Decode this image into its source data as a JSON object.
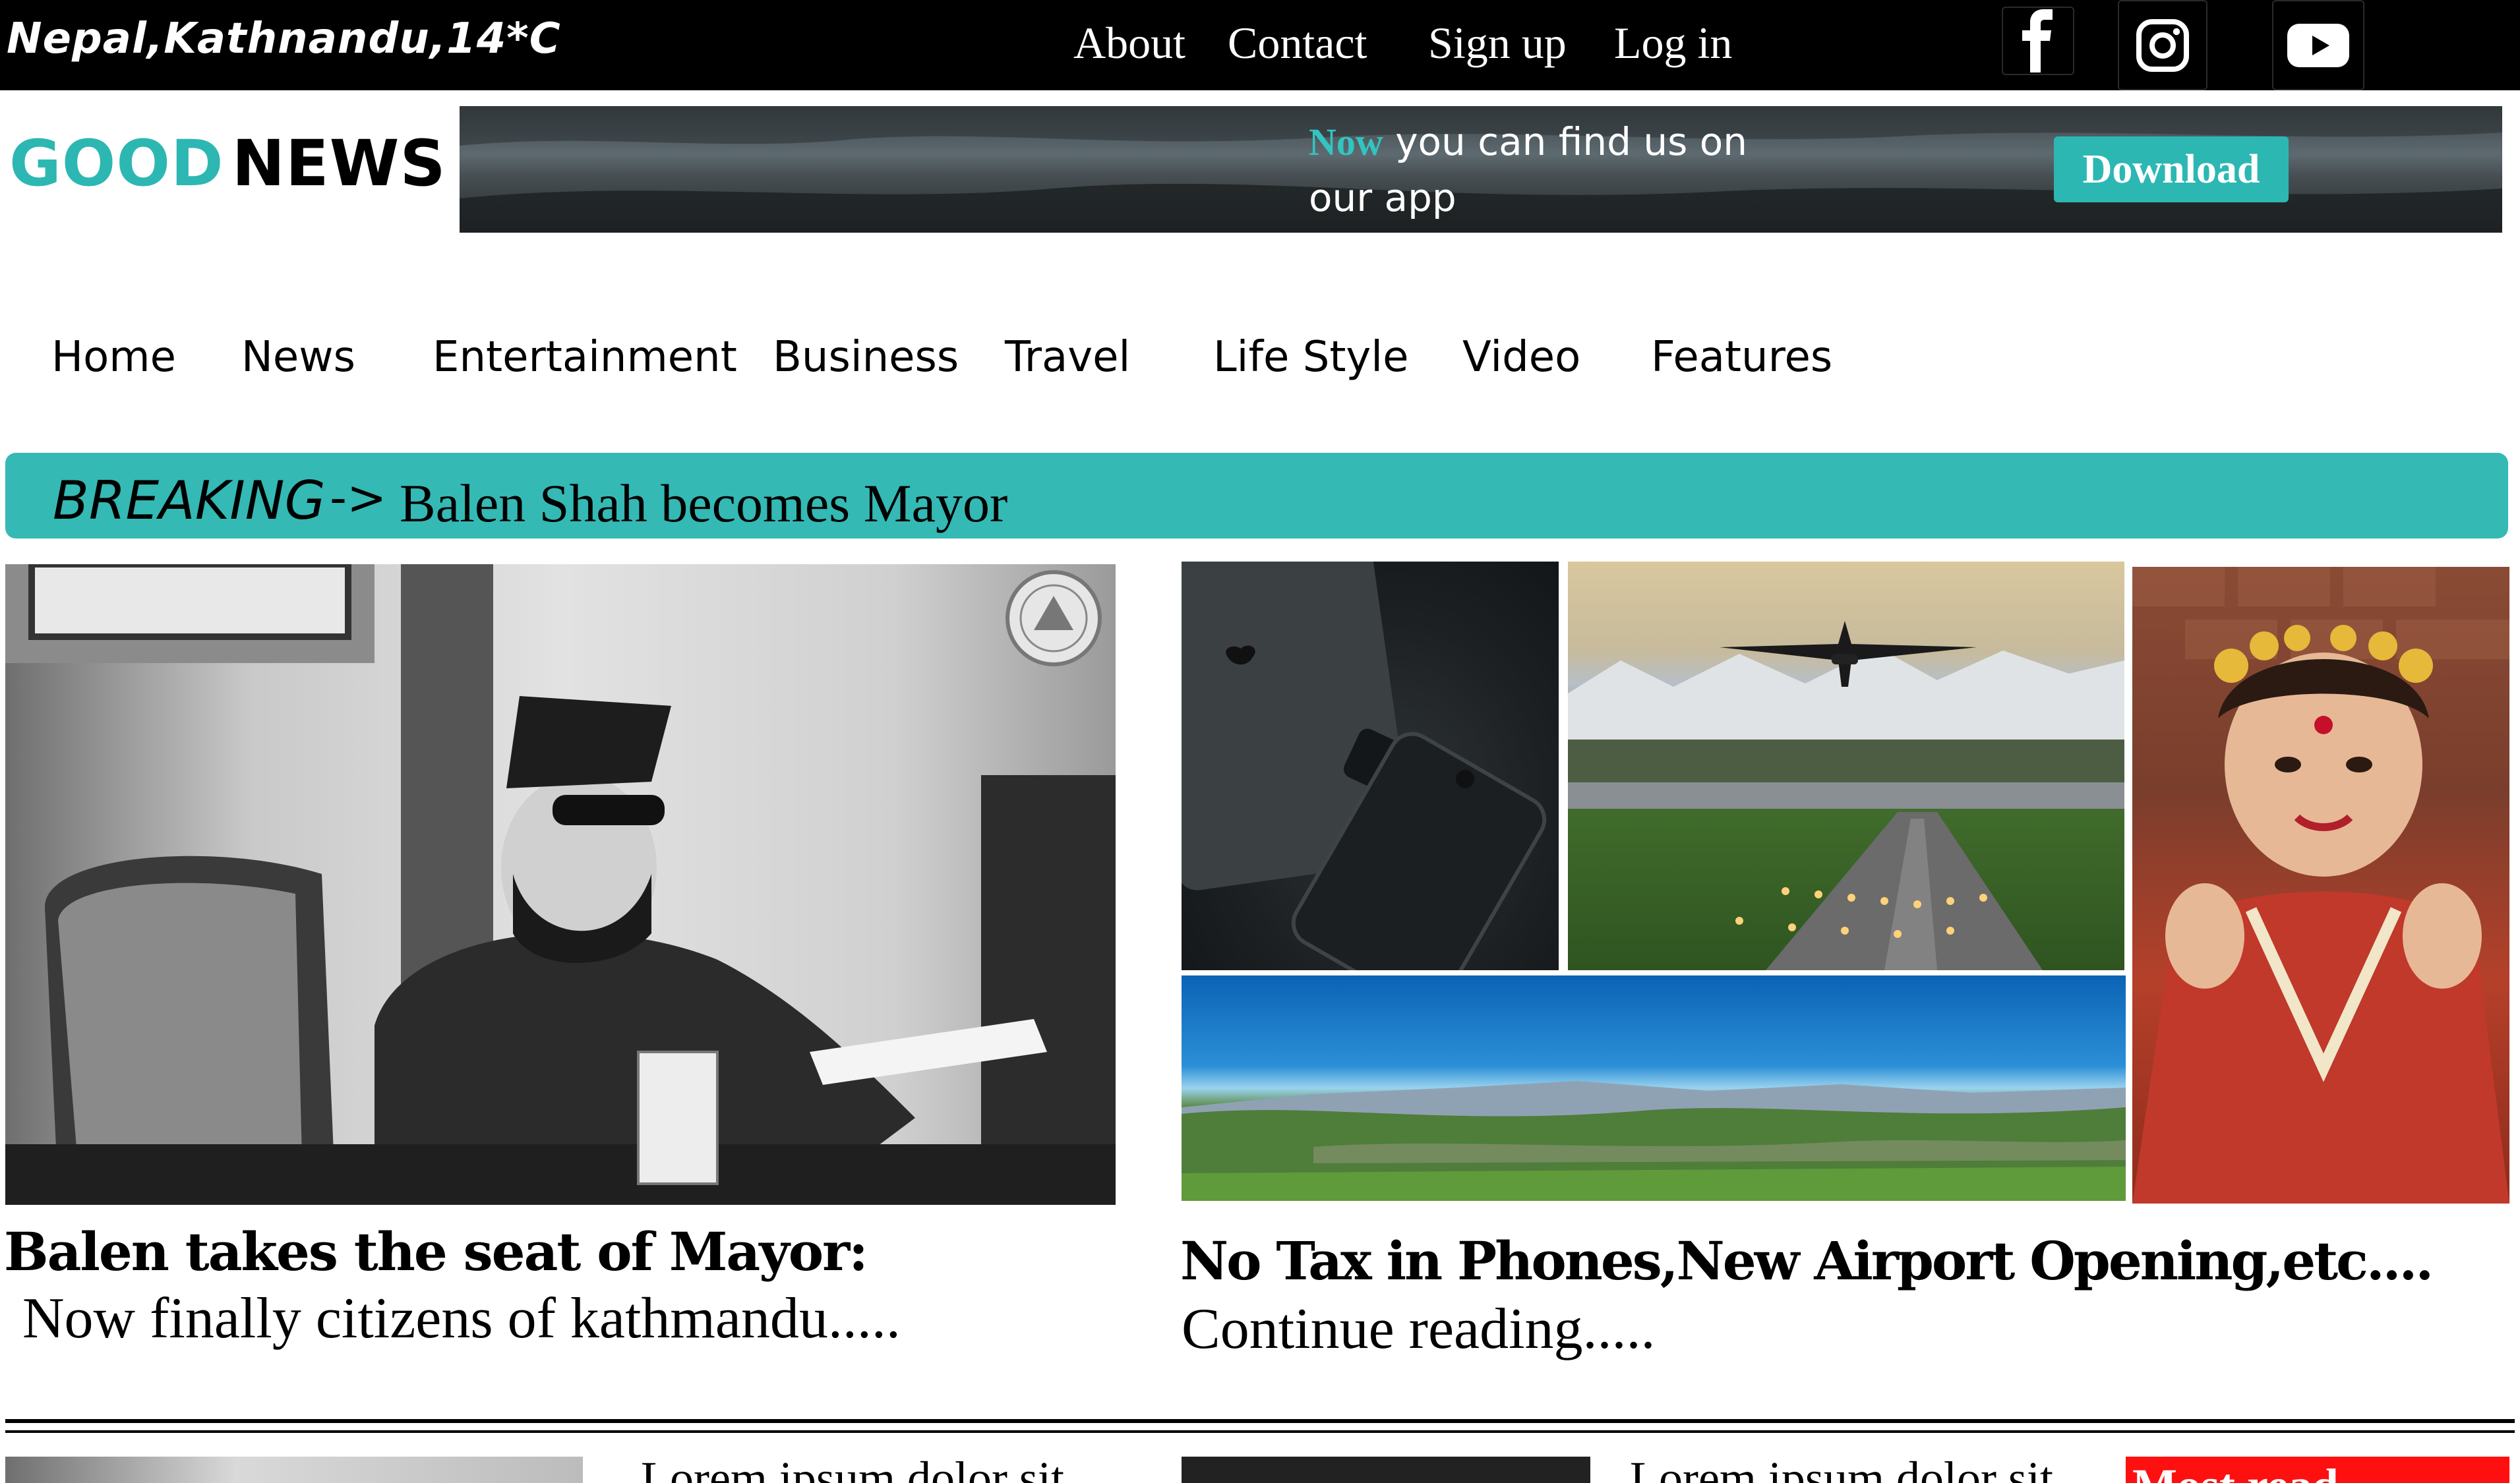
{
  "topbar": {
    "location": "Nepal,Kathnandu,14*C",
    "links": {
      "about": "About",
      "contact": "Contact",
      "signup": "Sign up",
      "login": "Log in"
    },
    "social": [
      "facebook-icon",
      "instagram-icon",
      "youtube-icon"
    ]
  },
  "logo": {
    "part1": "GOOD",
    "part2": "NEWS"
  },
  "banner": {
    "highlight": "Now",
    "line1": "you can find us on",
    "line2": "our app",
    "button": "Download"
  },
  "nav": {
    "home": "Home",
    "news": "News",
    "entertainment": "Entertainment",
    "business": "Business",
    "travel": "Travel",
    "lifestyle": "Life Style",
    "video": "Video",
    "features": "Features"
  },
  "breaking": {
    "label": "BREAKING",
    "arrow": "->",
    "headline": "Balen Shah becomes Mayor"
  },
  "hero": {
    "title": "Balen takes the seat of Mayor:",
    "teaser": "Now finally citizens of  kathmandu....."
  },
  "roundup": {
    "title": "No Tax in Phones,New Airport Opening,etc....",
    "link": "Continue reading....."
  },
  "second_row": {
    "text1": "Lorem ipsum dolor sit",
    "text2": "Lorem ipsum dolor sit",
    "red_box": "Most read"
  },
  "colors": {
    "accent": "#2db7b3",
    "topbar": "#000000",
    "alert": "#ff1010"
  }
}
